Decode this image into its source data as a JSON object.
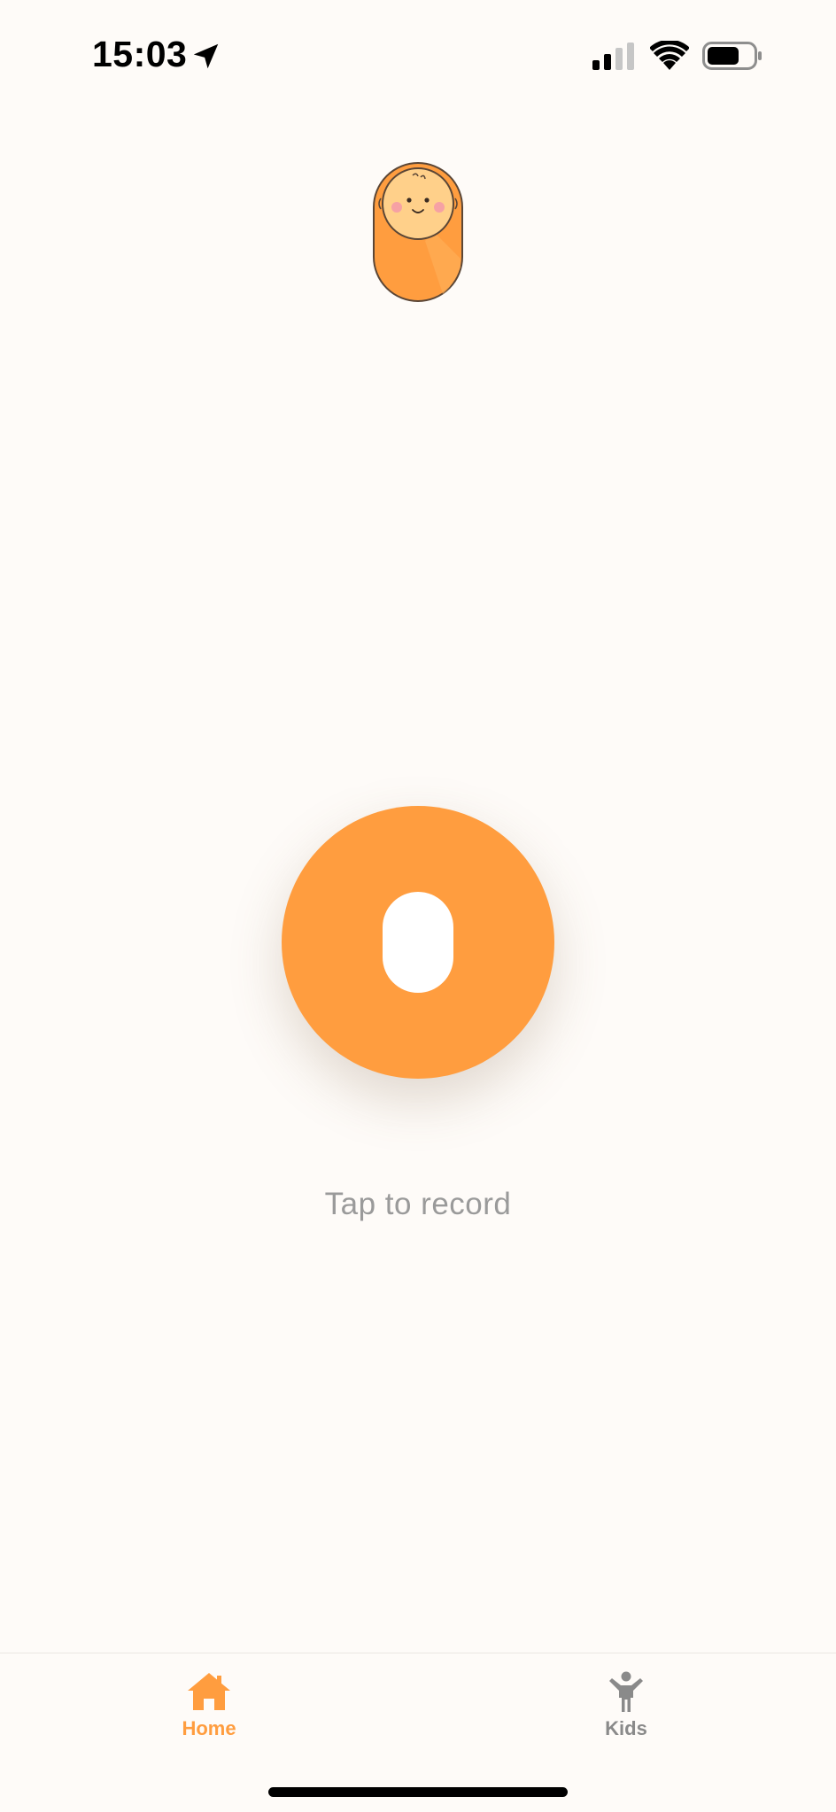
{
  "status_bar": {
    "time": "15:03",
    "location_icon": "location-arrow-icon",
    "signal_icon": "cellular-signal-icon",
    "wifi_icon": "wifi-icon",
    "battery_icon": "battery-icon",
    "battery_level": 0.7
  },
  "mascot": {
    "icon": "swaddled-baby-icon"
  },
  "record": {
    "button_icon": "record-icon",
    "hint": "Tap to record"
  },
  "tab_bar": {
    "tabs": [
      {
        "label": "Home",
        "icon": "home-icon",
        "active": true
      },
      {
        "label": "Kids",
        "icon": "child-icon",
        "active": false
      }
    ]
  },
  "colors": {
    "accent": "#ff9d3f",
    "background": "#fefbf8",
    "hint_text": "#9a9a9a",
    "inactive_tab": "#8a8a8a"
  }
}
